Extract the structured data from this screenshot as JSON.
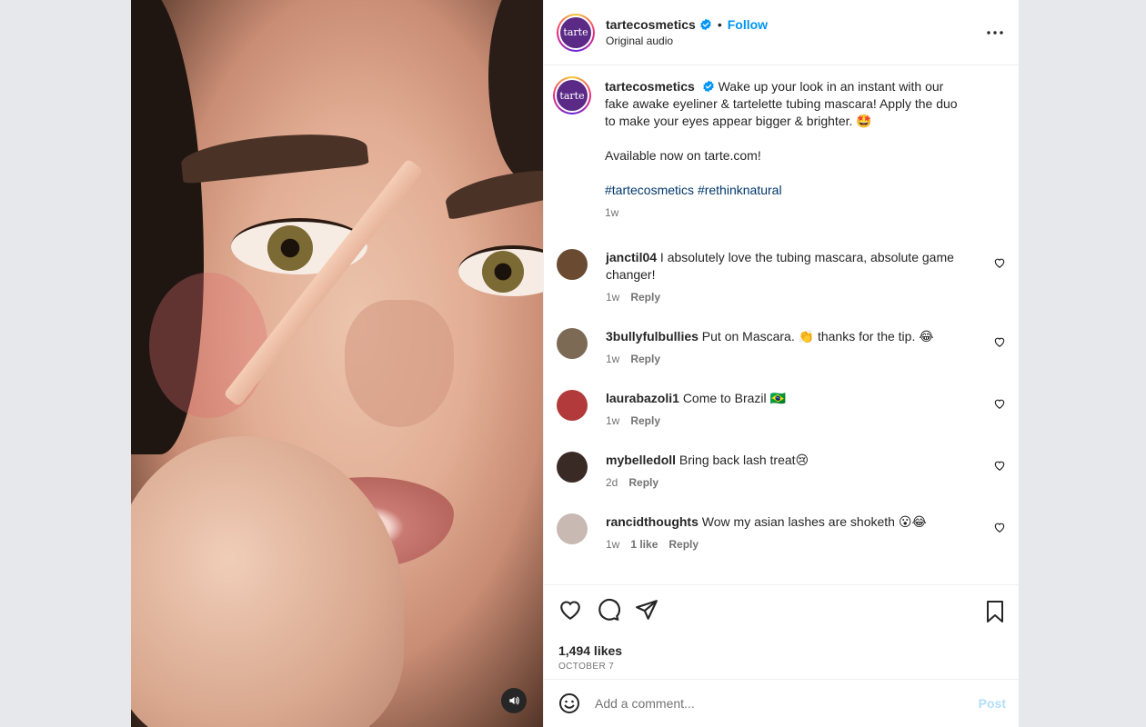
{
  "author": {
    "username": "tartecosmetics",
    "avatar_text": "tarte",
    "follow_label": "Follow",
    "audio_label": "Original audio",
    "verified_icon": "verified-badge-icon"
  },
  "caption": {
    "text": "Wake up your look in an instant with our fake awake eyeliner & tartelette tubing mascara! Apply the duo to make your eyes appear bigger & brighter. 🤩",
    "availability": "Available now on tarte.com!",
    "hashtags": [
      "#tartecosmetics",
      "#rethinknatural"
    ],
    "age": "1w"
  },
  "comments": [
    {
      "username": "janctil04",
      "text": "I absolutely love the tubing mascara, absolute game changer!",
      "age": "1w",
      "likes": "",
      "reply_label": "Reply",
      "avatar_color": "#6b4a32"
    },
    {
      "username": "3bullyfulbullies",
      "text": "Put on Mascara. 👏 thanks for the tip. 😂",
      "age": "1w",
      "likes": "",
      "reply_label": "Reply",
      "avatar_color": "#7d6a55"
    },
    {
      "username": "laurabazoli1",
      "text": "Come to Brazil 🇧🇷",
      "age": "1w",
      "likes": "",
      "reply_label": "Reply",
      "avatar_color": "#b23a3a"
    },
    {
      "username": "mybelledoll",
      "text": "Bring back lash treat😢",
      "age": "2d",
      "likes": "",
      "reply_label": "Reply",
      "avatar_color": "#3a2a26"
    },
    {
      "username": "rancidthoughts",
      "text": "Wow my asian lashes are shoketh 😮😂",
      "age": "1w",
      "likes": "1 like",
      "reply_label": "Reply",
      "avatar_color": "#c9b9b3"
    }
  ],
  "actions": {
    "likes_count": "1,494 likes",
    "date": "OCTOBER 7"
  },
  "composer": {
    "placeholder": "Add a comment...",
    "post_label": "Post"
  },
  "colors": {
    "follow": "#0095f6",
    "hashtag": "#00376b",
    "post_disabled": "#b2dffc",
    "brand": "#5b2a87"
  }
}
